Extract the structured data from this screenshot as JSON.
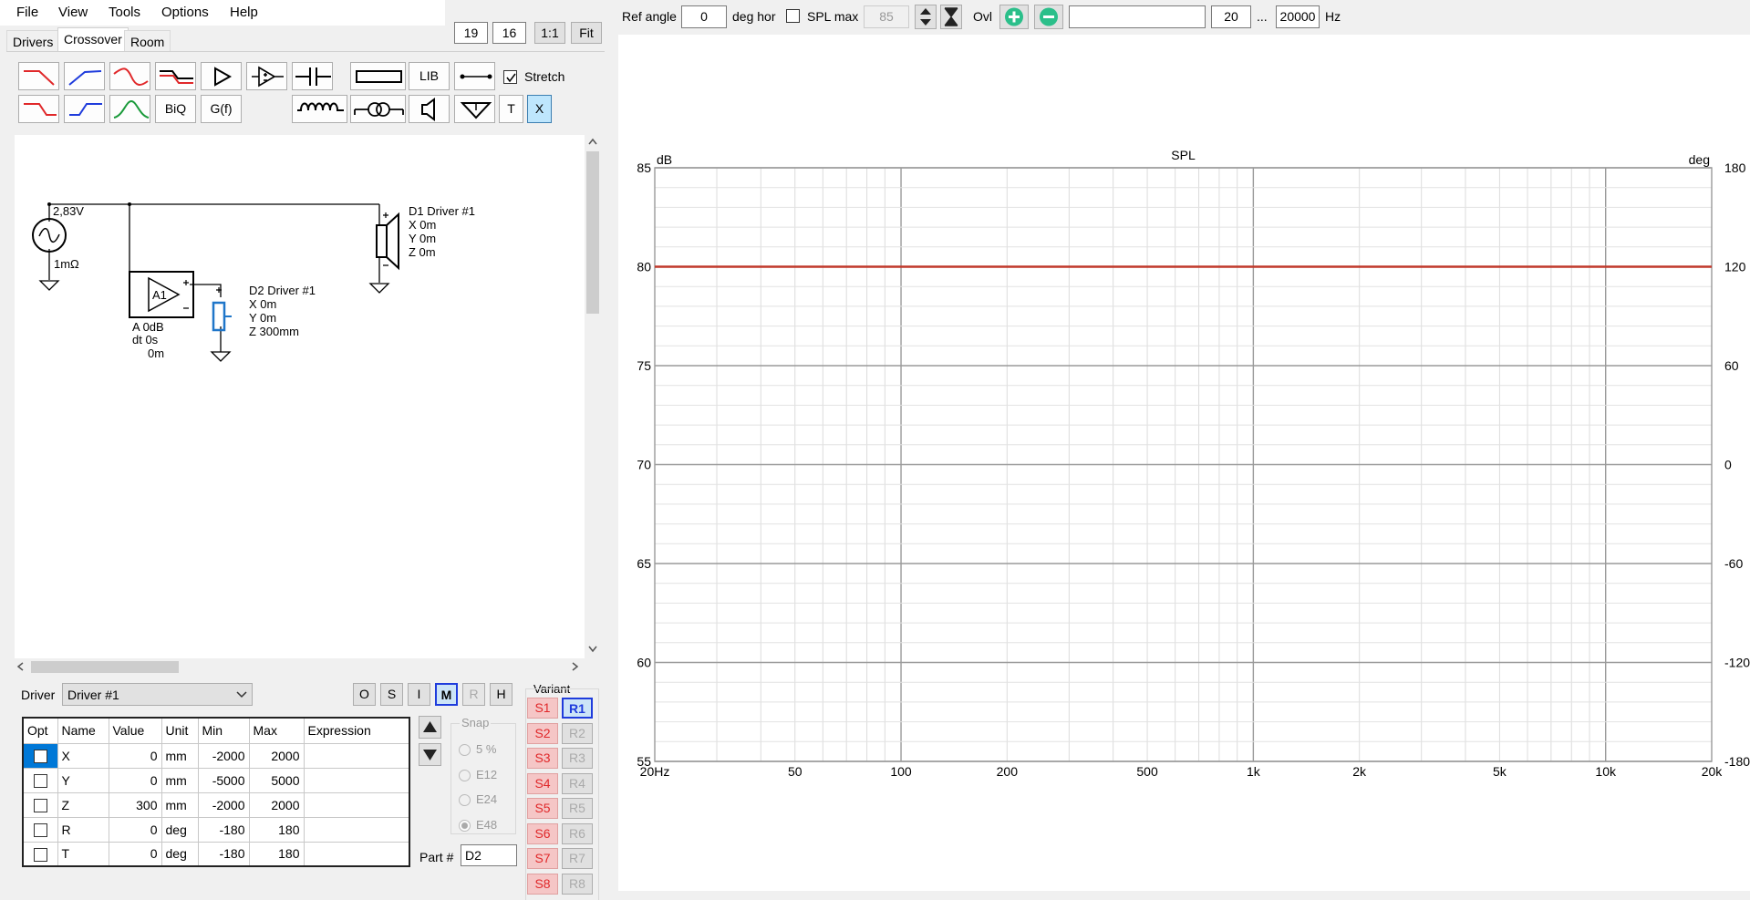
{
  "menu": [
    "File",
    "View",
    "Tools",
    "Options",
    "Help"
  ],
  "tabs": {
    "drivers": "Drivers",
    "crossover": "Crossover",
    "room": "Room"
  },
  "zoom": {
    "a": "19",
    "b": "16",
    "ratio": "1:1",
    "fit": "Fit"
  },
  "toolbar": {
    "biq": "BiQ",
    "gf": "G(f)",
    "lib": "LIB",
    "t": "T",
    "x": "X",
    "stretch": "Stretch"
  },
  "schematic": {
    "source_voltage": "2,83V",
    "source_res": "1mΩ",
    "amp_label": "A1",
    "amp_gain": "A  0dB",
    "amp_dt": "dt 0s",
    "amp_dist": "0m",
    "d1": [
      "D1 Driver #1",
      "X 0m",
      "Y 0m",
      "Z 0m"
    ],
    "d2": [
      "D2 Driver #1",
      "X 0m",
      "Y 0m",
      "Z 300mm"
    ]
  },
  "driver_label": "Driver",
  "driver_select": "Driver #1",
  "mode_buttons": [
    "O",
    "S",
    "I",
    "M",
    "R",
    "H"
  ],
  "table": {
    "headers": [
      "Opt",
      "Name",
      "Value",
      "Unit",
      "Min",
      "Max",
      "Expression"
    ],
    "rows": [
      [
        "X",
        "0",
        "mm",
        "-2000",
        "2000"
      ],
      [
        "Y",
        "0",
        "mm",
        "-5000",
        "5000"
      ],
      [
        "Z",
        "300",
        "mm",
        "-2000",
        "2000"
      ],
      [
        "R",
        "0",
        "deg",
        "-180",
        "180"
      ],
      [
        "T",
        "0",
        "deg",
        "-180",
        "180"
      ]
    ]
  },
  "snap": {
    "title": "Snap",
    "options": [
      "5 %",
      "E12",
      "E24",
      "E48"
    ]
  },
  "part_label": "Part #",
  "part_value": "D2",
  "variant": {
    "title": "Variant",
    "s": [
      "S1",
      "S2",
      "S3",
      "S4",
      "S5",
      "S6",
      "S7",
      "S8"
    ],
    "r": [
      "R1",
      "R2",
      "R3",
      "R4",
      "R5",
      "R6",
      "R7",
      "R8"
    ]
  },
  "top": {
    "ref_angle_label": "Ref angle",
    "ref_angle": "0",
    "deg_hor": "deg hor",
    "spl_max_label": "SPL max",
    "spl_max": "85",
    "ovl": "Ovl",
    "freq_from": "20",
    "dots": "...",
    "freq_to": "20000",
    "hz": "Hz"
  },
  "chart_data": {
    "type": "line",
    "title": "SPL",
    "ylabel": "dB",
    "y2label": "deg",
    "x_scale": "log",
    "xlim": [
      20,
      20000
    ],
    "ylim": [
      55,
      85
    ],
    "y2lim": [
      -180,
      180
    ],
    "x_ticks": [
      20,
      50,
      100,
      200,
      500,
      1000,
      2000,
      5000,
      10000,
      20000
    ],
    "x_tick_labels": [
      "20Hz",
      "50",
      "100",
      "200",
      "500",
      "1k",
      "2k",
      "5k",
      "10k",
      "20k"
    ],
    "y_ticks": [
      55,
      60,
      65,
      70,
      75,
      80,
      85
    ],
    "y2_ticks": [
      -180,
      -120,
      -60,
      0,
      60,
      120,
      180
    ],
    "grid": true,
    "series": [
      {
        "color": "#c0392b",
        "x": [
          20,
          20000
        ],
        "y": [
          80,
          80
        ]
      }
    ]
  },
  "colors": {
    "accent": "#0078d7",
    "curve": "#c0392b",
    "variant_s": "#e0282a",
    "grid": "#d8d8d8"
  }
}
